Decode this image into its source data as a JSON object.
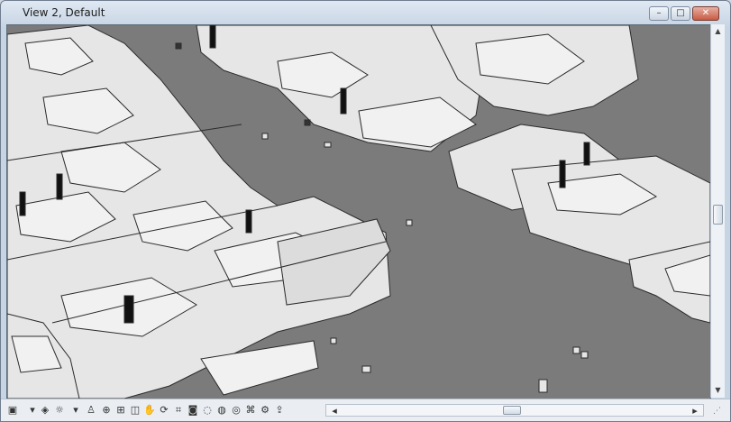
{
  "window": {
    "title": "View 2, Default",
    "minimize_label": "–",
    "maximize_label": "□",
    "close_label": "✕"
  },
  "viewport": {
    "scene": "3D city model view"
  },
  "toolbar": {
    "tools": [
      {
        "icon": "view-cube-icon",
        "glyph": "▣"
      },
      {
        "icon": "dropdown-arrow-icon",
        "glyph": "▾"
      },
      {
        "icon": "render-style-icon",
        "glyph": "◈"
      },
      {
        "icon": "sun-icon",
        "glyph": "☼"
      },
      {
        "icon": "dropdown-arrow-icon",
        "glyph": "▾"
      },
      {
        "icon": "walk-icon",
        "glyph": "♙"
      },
      {
        "icon": "zoom-icon",
        "glyph": "⊕"
      },
      {
        "icon": "zoom-window-icon",
        "glyph": "⊞"
      },
      {
        "icon": "section-box-icon",
        "glyph": "◫"
      },
      {
        "icon": "pan-icon",
        "glyph": "✋"
      },
      {
        "icon": "orbit-icon",
        "glyph": "⟳"
      },
      {
        "icon": "crop-icon",
        "glyph": "⌗"
      },
      {
        "icon": "camera-icon",
        "glyph": "◙"
      },
      {
        "icon": "hide-icon",
        "glyph": "◌"
      },
      {
        "icon": "isolate-icon",
        "glyph": "◍"
      },
      {
        "icon": "reveal-icon",
        "glyph": "◎"
      },
      {
        "icon": "analysis-icon",
        "glyph": "⌘"
      },
      {
        "icon": "settings-icon",
        "glyph": "⚙"
      },
      {
        "icon": "export-icon",
        "glyph": "⇪"
      }
    ],
    "scroll_left": "◂",
    "scroll_right": "▸"
  },
  "scrollbar": {
    "up": "▲",
    "down": "▼"
  }
}
